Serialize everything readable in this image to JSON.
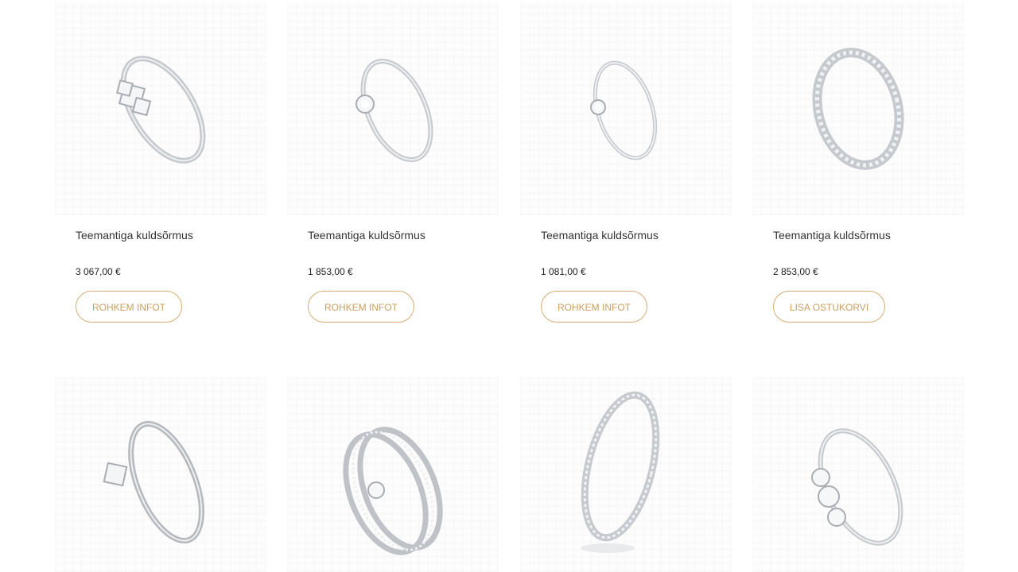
{
  "products": [
    {
      "title": "Teemantiga kuldsõrmus",
      "price": "3 067,00 €",
      "button": "ROHKEM INFOT",
      "image": "three-stone-princess-ring-image"
    },
    {
      "title": "Teemantiga kuldsõrmus",
      "price": "1 853,00 €",
      "button": "ROHKEM INFOT",
      "image": "solitaire-pave-shank-ring-image"
    },
    {
      "title": "Teemantiga kuldsõrmus",
      "price": "1 081,00 €",
      "button": "ROHKEM INFOT",
      "image": "solitaire-ring-image"
    },
    {
      "title": "Teemantiga kuldsõrmus",
      "price": "2 853,00 €",
      "button": "LISA OSTUKORVI",
      "image": "channel-set-band-image"
    },
    {
      "image": "princess-solitaire-ring-image"
    },
    {
      "image": "bridal-set-ring-image"
    },
    {
      "image": "eternity-band-ring-image"
    },
    {
      "image": "three-stone-round-ring-image"
    }
  ],
  "colors": {
    "accent": "#c9a062",
    "accent_border": "#d4ad74",
    "title_text": "#333333",
    "price_text": "#222222",
    "metal": "#b9bcc0"
  }
}
